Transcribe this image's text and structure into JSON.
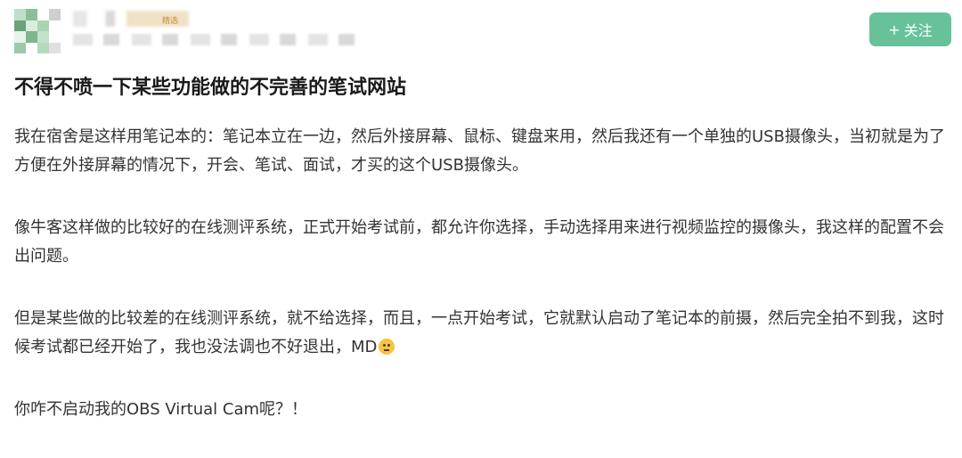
{
  "header": {
    "badge_text": "精选",
    "follow_button": {
      "icon": "plus-icon",
      "label": "关注",
      "plus": "+"
    },
    "colors": {
      "accent": "#67c29a"
    }
  },
  "post": {
    "title": "不得不喷一下某些功能做的不完善的笔试网站",
    "paragraphs": [
      "我在宿舍是这样用笔记本的：笔记本立在一边，然后外接屏幕、鼠标、键盘来用，然后我还有一个单独的USB摄像头，当初就是为了方便在外接屏幕的情况下，开会、笔试、面试，才买的这个USB摄像头。",
      "像牛客这样做的比较好的在线测评系统，正式开始考试前，都允许你选择，手动选择用来进行视频监控的摄像头，我这样的配置不会出问题。",
      "但是某些做的比较差的在线测评系统，就不给选择，而且，一点开始考试，它就默认启动了笔记本的前摄，然后完全拍不到我，这时候考试都已经开始了，我也没法调也不好退出，MD",
      "你咋不启动我的OBS Virtual Cam呢？！"
    ],
    "emoji": "awkward-face-icon"
  }
}
